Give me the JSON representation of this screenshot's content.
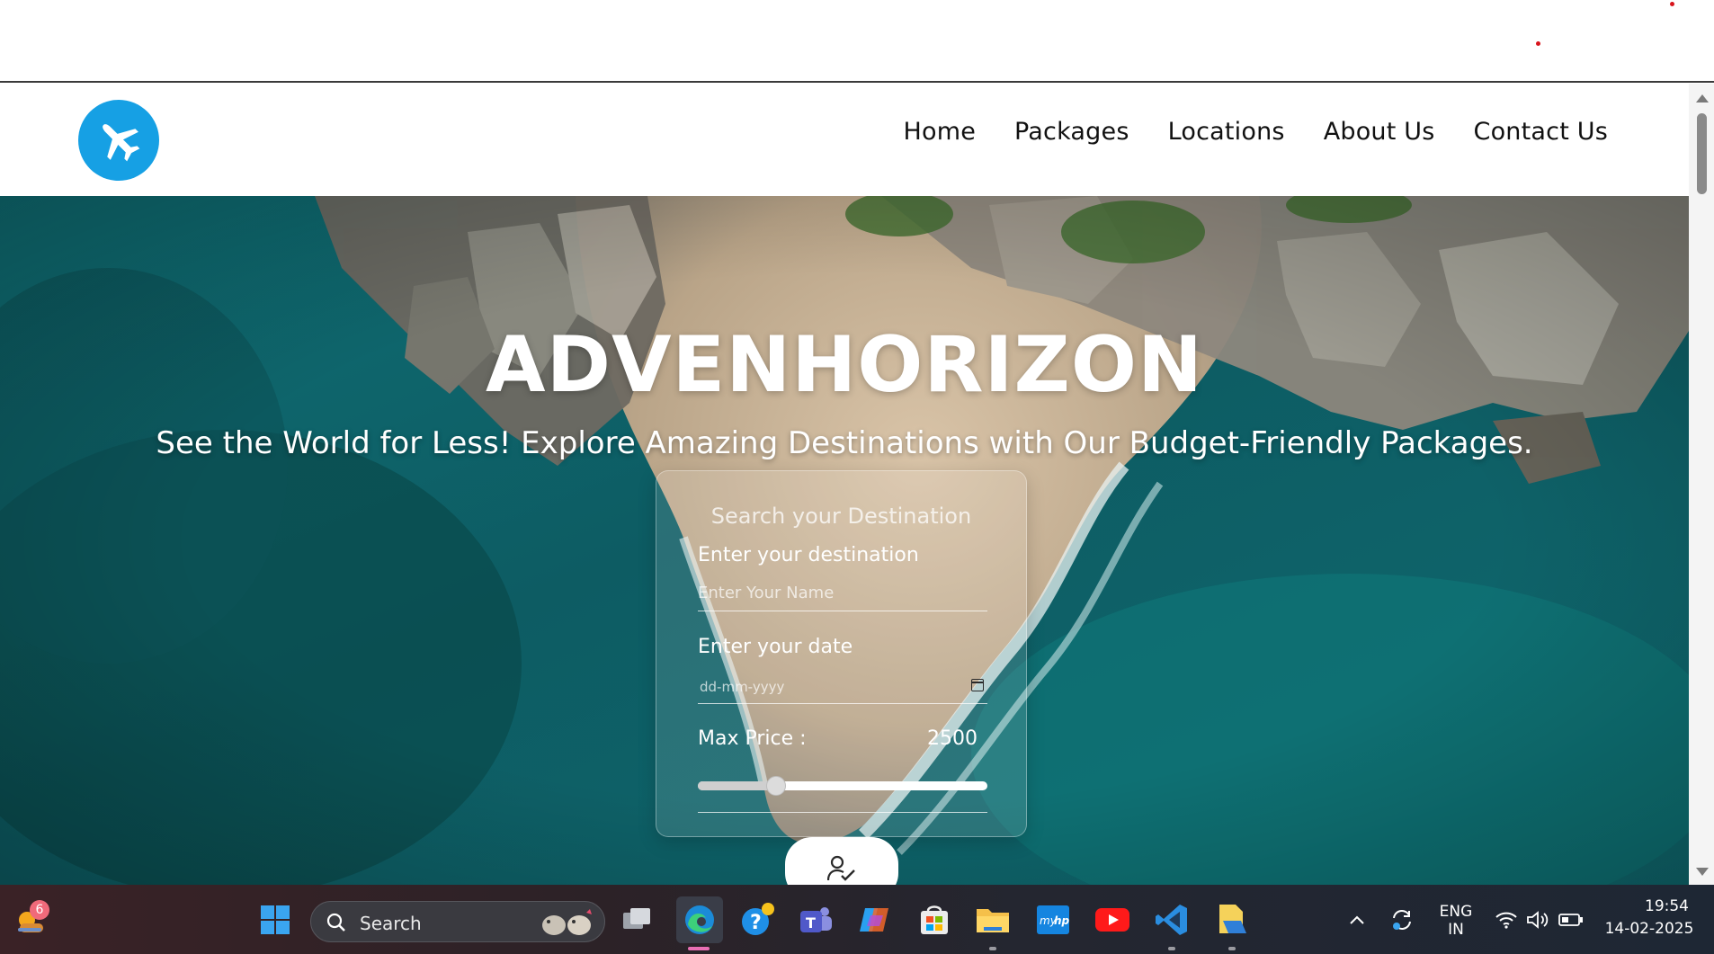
{
  "nav": {
    "items": [
      "Home",
      "Packages",
      "Locations",
      "About Us",
      "Contact Us"
    ]
  },
  "hero": {
    "title": "ADVENHORIZON",
    "subtitle": "See the World for Less! Explore Amazing Destinations with Our Budget-Friendly Packages."
  },
  "search_form": {
    "title": "Search your Destination",
    "destination_label": "Enter your destination",
    "destination_placeholder": "Enter Your Name",
    "date_label": "Enter your date",
    "date_placeholder": "dd-mm-yyyy",
    "price_label": "Max Price :",
    "price_value": "2500",
    "price_slider_fraction": 0.27
  },
  "taskbar": {
    "notification_count": "6",
    "search_label": "Search",
    "language_line1": "ENG",
    "language_line2": "IN",
    "time": "19:54",
    "date": "14-02-2025"
  },
  "colors": {
    "logo_blue": "#16a0e4",
    "accent_red_dot": "#d8141c"
  },
  "icons": [
    "airplane-icon",
    "calendar-icon",
    "user-check-icon",
    "windows-start-icon",
    "search-icon",
    "task-view-icon",
    "edge-icon",
    "help-icon",
    "teams-icon",
    "copilot-icon",
    "store-icon",
    "file-explorer-icon",
    "myhp-icon",
    "youtube-icon",
    "vscode-icon",
    "folder-app-icon",
    "chevron-up-icon",
    "sync-icon",
    "wifi-icon",
    "volume-icon",
    "battery-icon",
    "weather-icon"
  ]
}
